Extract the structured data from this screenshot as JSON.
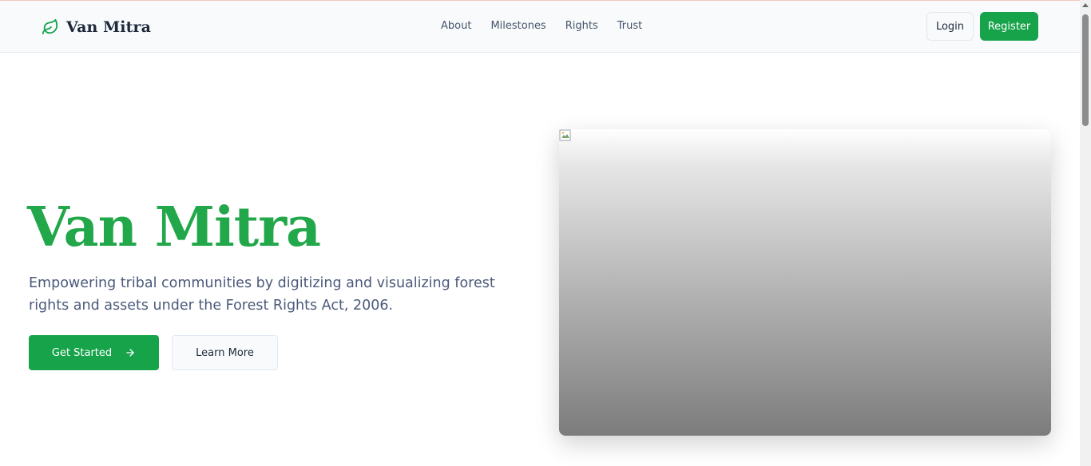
{
  "brand": {
    "name": "Van Mitra",
    "icon": "leaf-icon"
  },
  "nav": {
    "links": [
      "About",
      "Milestones",
      "Rights",
      "Trust"
    ],
    "login_label": "Login",
    "register_label": "Register"
  },
  "hero": {
    "title": "Van Mitra",
    "subtitle": "Empowering tribal communities by digitizing and visualizing forest rights and assets under the Forest Rights Act, 2006.",
    "primary_button": "Get Started",
    "primary_button_icon": "arrow-right-icon",
    "secondary_button": "Learn More",
    "image_state": "broken-image"
  },
  "colors": {
    "accent": "#16a34a",
    "title_green": "#22a84a",
    "nav_bg": "#f8fafc",
    "text_muted": "#475569"
  }
}
